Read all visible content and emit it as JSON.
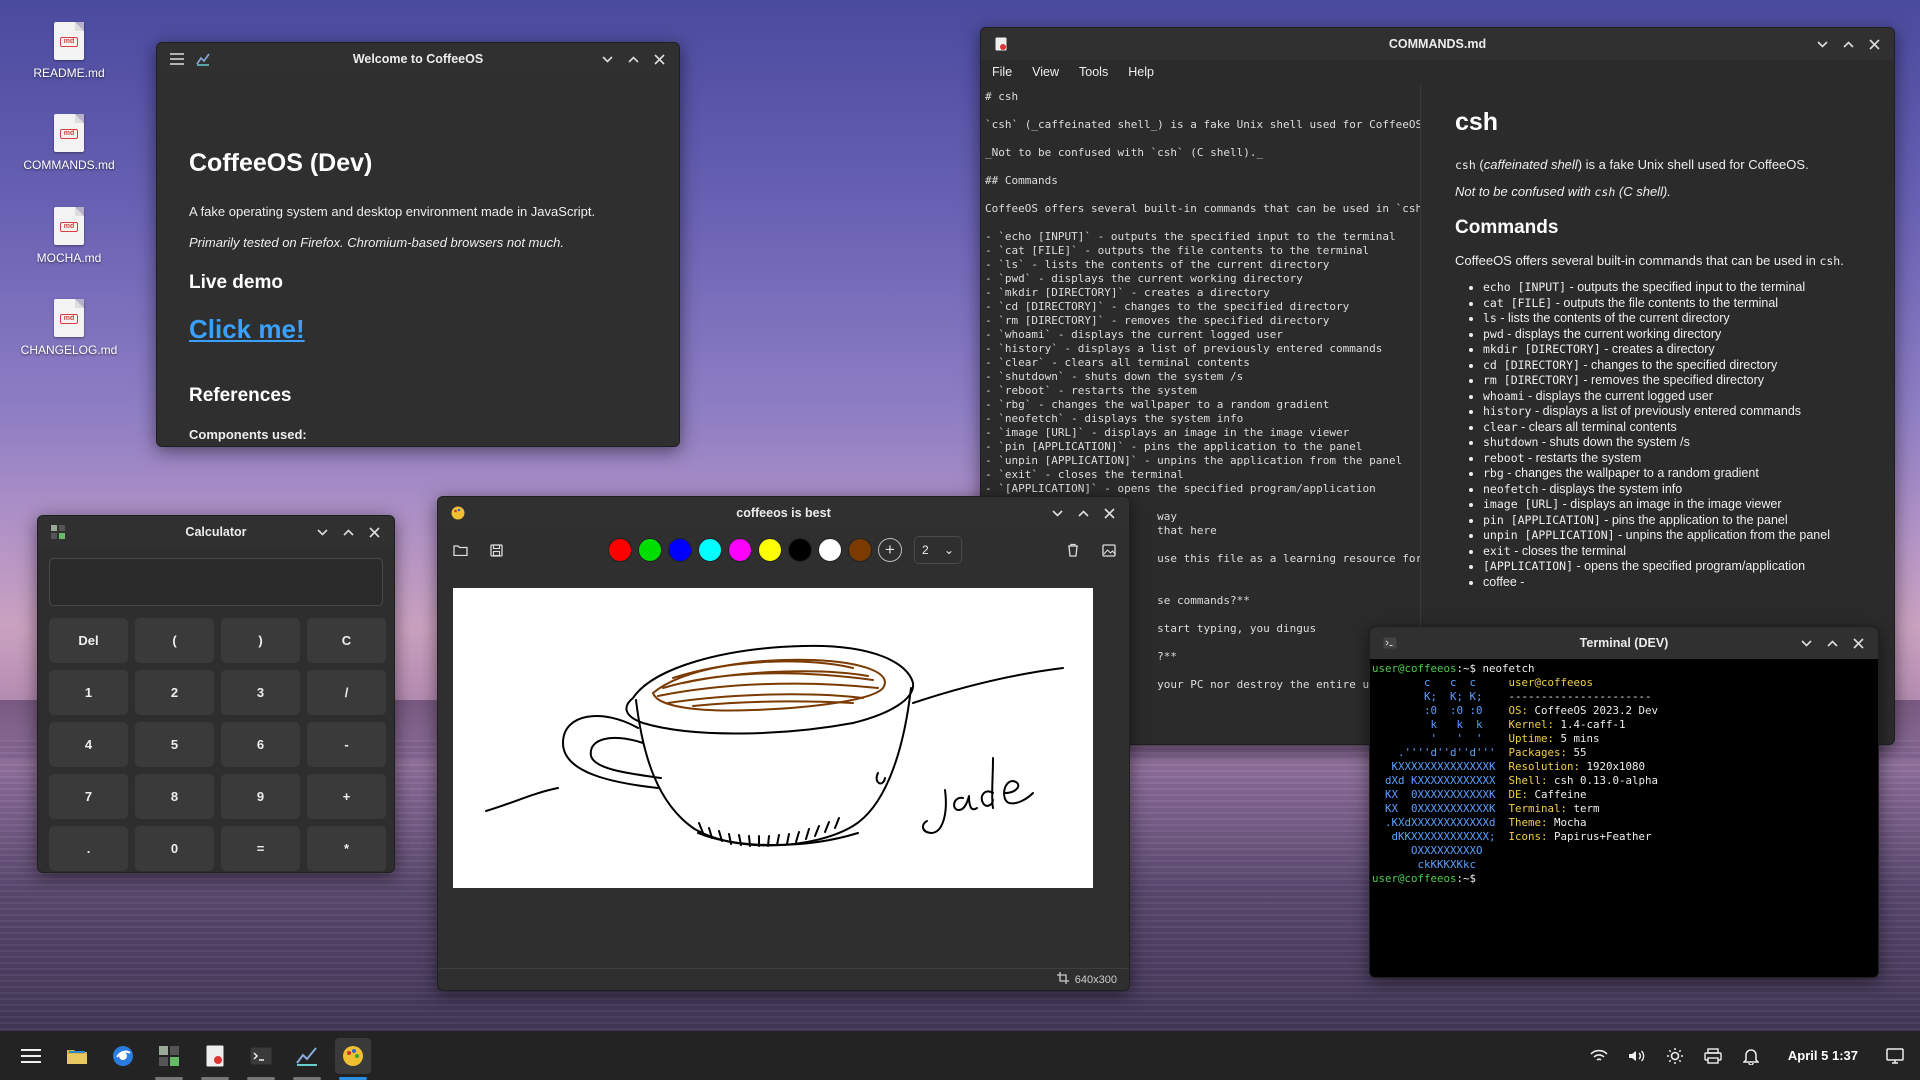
{
  "desktop": {
    "icons": [
      {
        "label": "README.md"
      },
      {
        "label": "COMMANDS.md"
      },
      {
        "label": "MOCHA.md"
      },
      {
        "label": "CHANGELOG.md"
      }
    ],
    "file_badge": "md"
  },
  "welcome": {
    "title": "Welcome to CoffeeOS",
    "heading": "CoffeeOS (Dev)",
    "desc": "A fake operating system and desktop environment made in JavaScript.",
    "note": "Primarily tested on Firefox. Chromium-based browsers not much.",
    "live_demo": "Live demo",
    "link": "Click me!",
    "references": "References",
    "components": "Components used:"
  },
  "commands": {
    "title": "COMMANDS.md",
    "menu": [
      "File",
      "View",
      "Tools",
      "Help"
    ],
    "editor_lines": [
      "# csh",
      "",
      "`csh` (_caffeinated shell_) is a fake Unix shell used for CoffeeOS",
      "",
      "_Not to be confused with `csh` (C shell)._",
      "",
      "## Commands",
      "",
      "CoffeeOS offers several built-in commands that can be used in `csh`",
      "",
      "- `echo [INPUT]` - outputs the specified input to the terminal",
      "- `cat [FILE]` - outputs the file contents to the terminal",
      "- `ls` - lists the contents of the current directory",
      "- `pwd` - displays the current working directory",
      "- `mkdir [DIRECTORY]` - creates a directory",
      "- `cd [DIRECTORY]` - changes to the specified directory",
      "- `rm [DIRECTORY]` - removes the specified directory",
      "- `whoami` - displays the current logged user",
      "- `history` - displays a list of previously entered commands",
      "- `clear` - clears all terminal contents",
      "- `shutdown` - shuts down the system /s",
      "- `reboot` - restarts the system",
      "- `rbg` - changes the wallpaper to a random gradient",
      "- `neofetch` - displays the system info",
      "- `image [URL]` - displays an image in the image viewer",
      "- `pin [APPLICATION]` - pins the application to the panel",
      "- `unpin [APPLICATION]` - unpins the application from the panel",
      "- `exit` - closes the terminal",
      "- `[APPLICATION]` - opens the specified program/application",
      "",
      "                          way",
      "                          that here",
      "",
      "                          use this file as a learning resource for ba",
      "",
      "",
      "                          se commands?**",
      "",
      "                          start typing, you dingus",
      "",
      "                          ?**",
      "",
      "                          your PC nor destroy the entire univer"
    ],
    "preview": {
      "h1": "csh",
      "intro_code": "csh",
      "intro_em": "caffeinated shell",
      "intro_rest": "is a fake Unix shell used for CoffeeOS.",
      "note_a": "Not to be confused with",
      "note_code": "csh",
      "note_b": "(C shell).",
      "h2": "Commands",
      "lead": "CoffeeOS offers several built-in commands that can be used in",
      "lead_code": "csh",
      "items": [
        {
          "code": "echo [INPUT]",
          "text": "- outputs the specified input to the terminal"
        },
        {
          "code": "cat [FILE]",
          "text": "- outputs the file contents to the terminal"
        },
        {
          "code": "ls",
          "text": "- lists the contents of the current directory"
        },
        {
          "code": "pwd",
          "text": "- displays the current working directory"
        },
        {
          "code": "mkdir [DIRECTORY]",
          "text": "- creates a directory"
        },
        {
          "code": "cd [DIRECTORY]",
          "text": "- changes to the specified directory"
        },
        {
          "code": "rm [DIRECTORY]",
          "text": "- removes the specified directory"
        },
        {
          "code": "whoami",
          "text": "- displays the current logged user"
        },
        {
          "code": "history",
          "text": "- displays a list of previously entered commands"
        },
        {
          "code": "clear",
          "text": "- clears all terminal contents"
        },
        {
          "code": "shutdown",
          "text": "- shuts down the system /s"
        },
        {
          "code": "reboot",
          "text": "- restarts the system"
        },
        {
          "code": "rbg",
          "text": "- changes the wallpaper to a random gradient"
        },
        {
          "code": "neofetch",
          "text": "- displays the system info"
        },
        {
          "code": "image [URL]",
          "text": "- displays an image in the image viewer"
        },
        {
          "code": "pin [APPLICATION]",
          "text": "- pins the application to the panel"
        },
        {
          "code": "unpin [APPLICATION]",
          "text": "- unpins the application from the panel"
        },
        {
          "code": "exit",
          "text": "- closes the terminal"
        },
        {
          "code": "[APPLICATION]",
          "text": "- opens the specified program/application"
        },
        {
          "code": "",
          "text": "coffee -"
        }
      ]
    }
  },
  "calculator": {
    "title": "Calculator",
    "display": "",
    "keys": [
      "Del",
      "(",
      ")",
      "C",
      "1",
      "2",
      "3",
      "/",
      "4",
      "5",
      "6",
      "-",
      "7",
      "8",
      "9",
      "+",
      ".",
      "0",
      "=",
      "*"
    ]
  },
  "paint": {
    "title": "coffeeos is best",
    "colors": [
      "#ff0000",
      "#00dd00",
      "#0000ff",
      "#00ffff",
      "#ff00ff",
      "#ffff00",
      "#000000",
      "#ffffff",
      "#7a3a00"
    ],
    "brush_size": "2",
    "canvas_size": "640x300",
    "signature": "jade"
  },
  "terminal": {
    "title": "Terminal (DEV)",
    "prompt_user": "user@coffeeos",
    "prompt_path": ":~$",
    "command": " neofetch",
    "logo": [
      "        c   c  c   ",
      "        K;  K; K;  ",
      "        :0  :0 :0  ",
      "         k   k  k  ",
      "         '   '  '  ",
      "    .''''d''d''d'''",
      "   KXXXXXXXXXXXXXXK",
      "  dXd KXXXXXXXXXXXX",
      "  KX  0XXXXXXXXXXXK",
      "  KX  0XXXXXXXXXXXK",
      "  .KXdXXXXXXXXXXXXd",
      "   dKKXXXXXXXXXXXX;",
      "      OXXXXXXXXXO  ",
      "       ckKKKXKkc   "
    ],
    "header": "user@coffeeos",
    "separator": "----------------------",
    "info": [
      {
        "key": "OS",
        "value": "CoffeeOS 2023.2 Dev"
      },
      {
        "key": "Kernel",
        "value": "1.4-caff-1"
      },
      {
        "key": "Uptime",
        "value": "5 mins"
      },
      {
        "key": "Packages",
        "value": "55"
      },
      {
        "key": "Resolution",
        "value": "1920x1080"
      },
      {
        "key": "Shell",
        "value": "csh 0.13.0-alpha"
      },
      {
        "key": "DE",
        "value": "Caffeine"
      },
      {
        "key": "Terminal",
        "value": "term"
      },
      {
        "key": "Theme",
        "value": "Mocha"
      },
      {
        "key": "Icons",
        "value": "Papirus+Feather"
      }
    ]
  },
  "taskbar": {
    "clock": "April 5 1:37"
  }
}
